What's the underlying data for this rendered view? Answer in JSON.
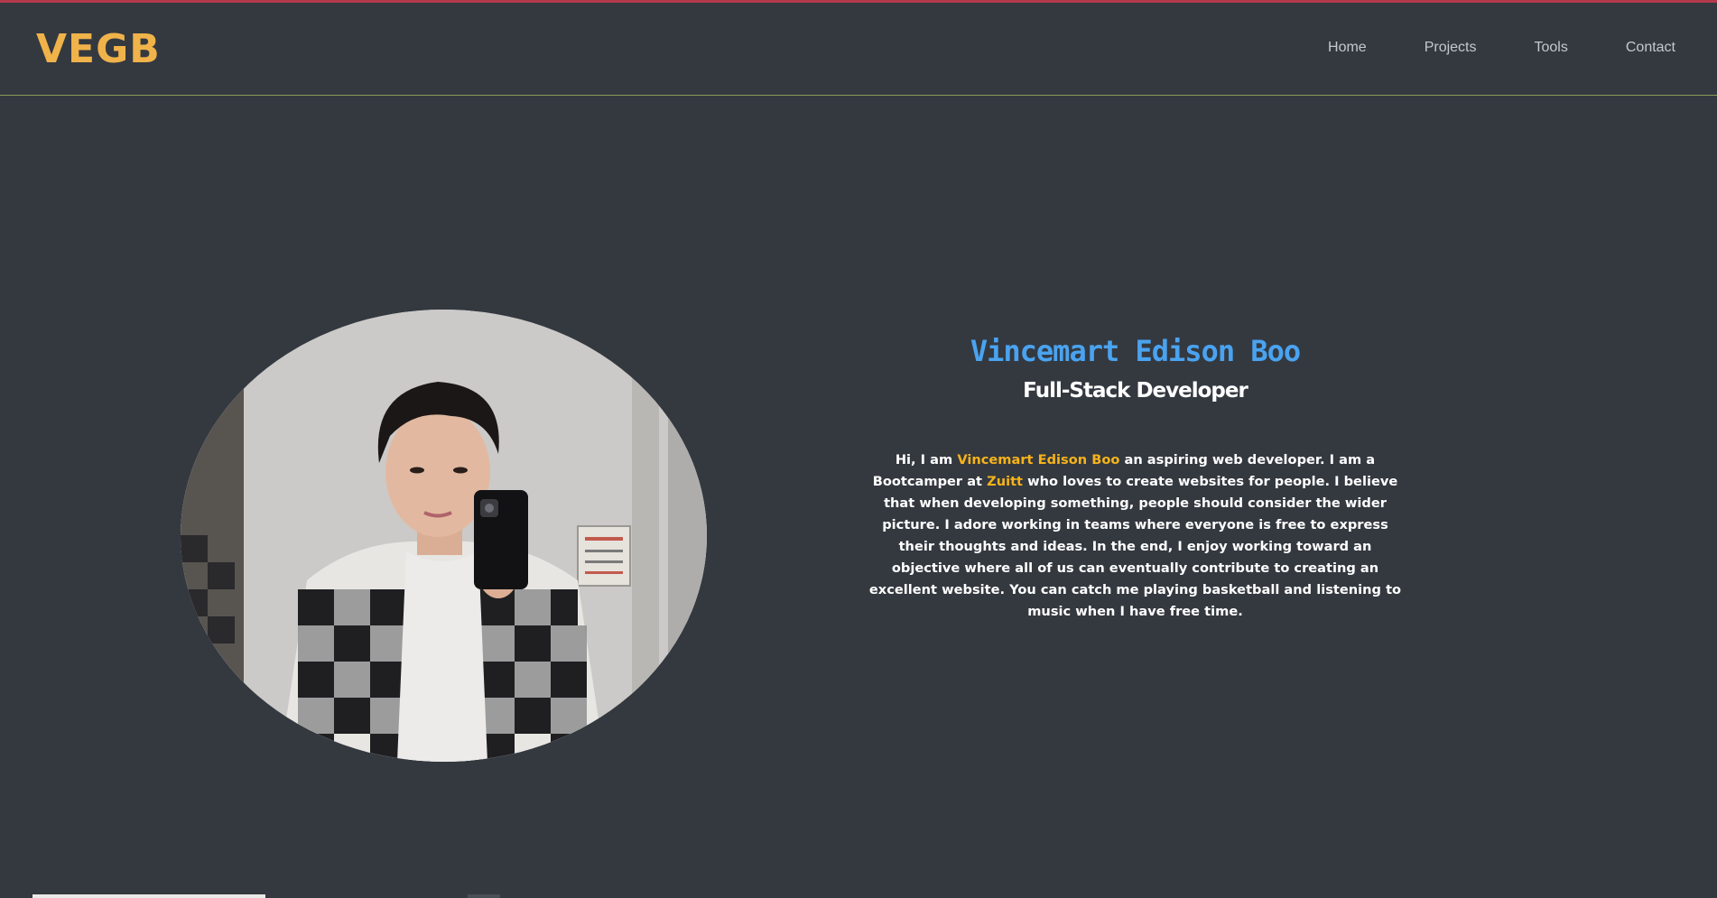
{
  "brand": {
    "logo": "VEGB",
    "accent": "#f0b34a"
  },
  "nav": {
    "items": [
      {
        "label": "Home"
      },
      {
        "label": "Projects"
      },
      {
        "label": "Tools"
      },
      {
        "label": "Contact"
      }
    ]
  },
  "hero": {
    "name": "Vincemart Edison Boo",
    "role": "Full-Stack Developer",
    "intro": {
      "p1": "Hi, I am ",
      "name_highlight": "Vincemart Edison Boo",
      "p2": " an aspiring web developer. I am a Bootcamper at ",
      "org_highlight": "Zuitt",
      "p3": " who loves to create websites for people. I believe that when developing something, people should consider the wider picture. I adore working in teams where everyone is free to express their thoughts and ideas. In the end, I enjoy working toward an objective where all of us can eventually contribute to creating an excellent website. You can catch me playing basketball and listening to music when I have free time."
    },
    "colors": {
      "name": "#4aa3f0",
      "highlight": "#f6b31a",
      "background": "#343940"
    }
  }
}
